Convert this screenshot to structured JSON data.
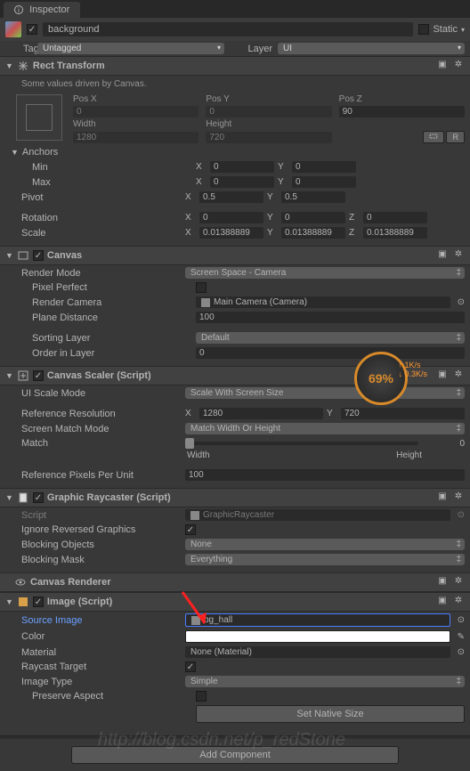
{
  "tab": {
    "title": "Inspector"
  },
  "header": {
    "name": "background",
    "staticLabel": "Static",
    "tagLabel": "Tag",
    "tagValue": "Untagged",
    "layerLabel": "Layer",
    "layerValue": "UI"
  },
  "rectTransform": {
    "title": "Rect Transform",
    "drivenMsg": "Some values driven by Canvas.",
    "posXLabel": "Pos X",
    "posX": "0",
    "posYLabel": "Pos Y",
    "posY": "0",
    "posZLabel": "Pos Z",
    "posZ": "90",
    "widthLabel": "Width",
    "width": "1280",
    "heightLabel": "Height",
    "height": "720",
    "anchorsLabel": "Anchors",
    "minLabel": "Min",
    "minX": "0",
    "minY": "0",
    "maxLabel": "Max",
    "maxX": "0",
    "maxY": "0",
    "pivotLabel": "Pivot",
    "pivotX": "0.5",
    "pivotY": "0.5",
    "rotationLabel": "Rotation",
    "rotX": "0",
    "rotY": "0",
    "rotZ": "0",
    "scaleLabel": "Scale",
    "scaleX": "0.01388889",
    "scaleY": "0.01388889",
    "scaleZ": "0.01388889",
    "rBtn": "R"
  },
  "canvas": {
    "title": "Canvas",
    "renderModeLabel": "Render Mode",
    "renderMode": "Screen Space - Camera",
    "pixelPerfectLabel": "Pixel Perfect",
    "renderCameraLabel": "Render Camera",
    "renderCamera": "Main Camera (Camera)",
    "planeDistanceLabel": "Plane Distance",
    "planeDistance": "100",
    "sortingLayerLabel": "Sorting Layer",
    "sortingLayer": "Default",
    "orderInLayerLabel": "Order in Layer",
    "orderInLayer": "0"
  },
  "scaler": {
    "title": "Canvas Scaler (Script)",
    "uiScaleModeLabel": "UI Scale Mode",
    "uiScaleMode": "Scale With Screen Size",
    "refResLabel": "Reference Resolution",
    "refResX": "1280",
    "refResY": "720",
    "matchModeLabel": "Screen Match Mode",
    "matchMode": "Match Width Or Height",
    "matchLabel": "Match",
    "matchValue": "0",
    "widthLabel": "Width",
    "heightLabel": "Height",
    "refPixelsLabel": "Reference Pixels Per Unit",
    "refPixels": "100"
  },
  "raycaster": {
    "title": "Graphic Raycaster (Script)",
    "scriptLabel": "Script",
    "script": "GraphicRaycaster",
    "ignoreRevLabel": "Ignore Reversed Graphics",
    "blockingObjLabel": "Blocking Objects",
    "blockingObj": "None",
    "blockingMaskLabel": "Blocking Mask",
    "blockingMask": "Everything"
  },
  "canvasRenderer": {
    "title": "Canvas Renderer"
  },
  "image": {
    "title": "Image (Script)",
    "sourceLabel": "Source Image",
    "source": "bg_hall",
    "colorLabel": "Color",
    "materialLabel": "Material",
    "material": "None (Material)",
    "raycastTargetLabel": "Raycast Target",
    "imageTypeLabel": "Image Type",
    "imageType": "Simple",
    "preserveAspectLabel": "Preserve Aspect",
    "setNativeSizeLabel": "Set Native Size"
  },
  "addComponent": "Add Component",
  "overlay": {
    "percent": "69%",
    "up": "1K/s",
    "down": "0.3K/s"
  },
  "watermark": "http://blog.csdn.net/p_redStone"
}
